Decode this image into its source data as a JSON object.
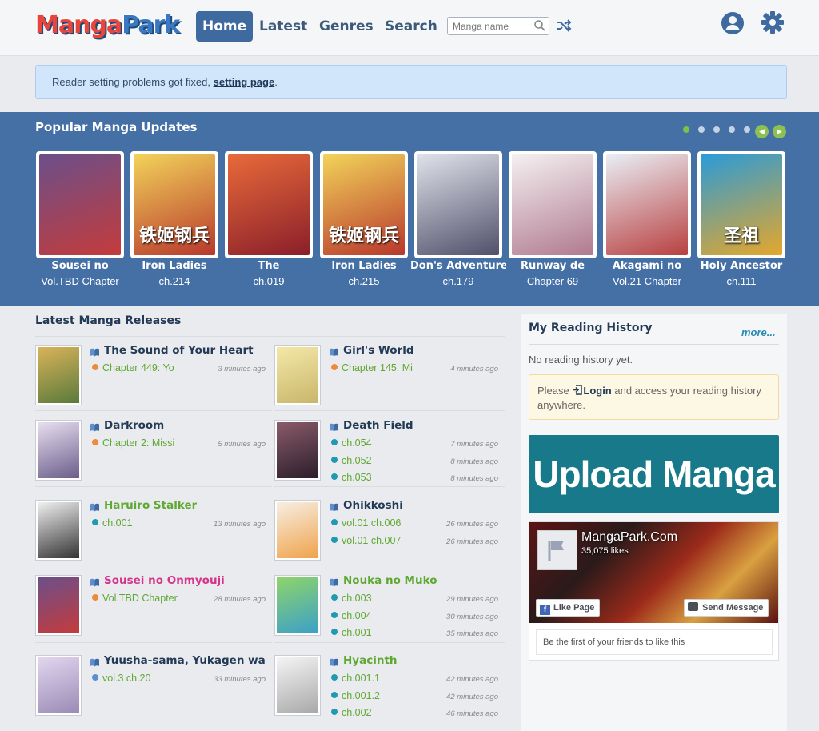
{
  "header": {
    "logo_a": "Manga",
    "logo_b": "Park",
    "nav": [
      "Home",
      "Latest",
      "Genres",
      "Search"
    ],
    "search_placeholder": "Manga name"
  },
  "notice": {
    "text": "Reader setting problems got fixed, ",
    "link": "setting page",
    "end": "."
  },
  "popular": {
    "title": "Popular Manga Updates",
    "items": [
      {
        "name": "Sousei no",
        "chapter": "Vol.TBD Chapter",
        "c1": "#6b4f8a",
        "c2": "#c43b3b"
      },
      {
        "name": "Iron Ladies",
        "chapter": "ch.214",
        "c1": "#f2d35a",
        "c2": "#b8382c",
        "mark": "铁姬钢兵"
      },
      {
        "name": "The",
        "chapter": "ch.019",
        "c1": "#e86a3a",
        "c2": "#8a1f2a"
      },
      {
        "name": "Iron Ladies",
        "chapter": "ch.215",
        "c1": "#f2d35a",
        "c2": "#b8382c",
        "mark": "铁姬钢兵"
      },
      {
        "name": "Don's Adventure",
        "chapter": "ch.179",
        "c1": "#dfe2ea",
        "c2": "#50506a"
      },
      {
        "name": "Runway de",
        "chapter": "Chapter 69",
        "c1": "#f4f0f2",
        "c2": "#b07a8e"
      },
      {
        "name": "Akagami no",
        "chapter": "Vol.21 Chapter",
        "c1": "#e9eef5",
        "c2": "#b84040"
      },
      {
        "name": "Holy Ancestor",
        "chapter": "ch.111",
        "c1": "#2a9bd8",
        "c2": "#e6a72a",
        "mark": "圣祖"
      }
    ]
  },
  "latest": {
    "title": "Latest Manga Releases",
    "left": [
      {
        "title": "The Sound of Your Heart",
        "color": "#233a56",
        "c1": "#d9b35a",
        "c2": "#5a7a3a",
        "chapters": [
          {
            "text": "Chapter 449: Yo",
            "time": "3 minutes ago",
            "bullet": "#ee8a3a",
            "color": "#5fa832"
          }
        ]
      },
      {
        "title": "Darkroom",
        "color": "#233a56",
        "c1": "#e7dff0",
        "c2": "#6b5d8a",
        "chapters": [
          {
            "text": "Chapter 2: Missi",
            "time": "5 minutes ago",
            "bullet": "#ee8a3a",
            "color": "#5fa832"
          }
        ]
      },
      {
        "title": "Haruiro Stalker",
        "color": "#5fa832",
        "c1": "#f0f0f0",
        "c2": "#333333",
        "chapters": [
          {
            "text": "ch.001",
            "time": "13 minutes ago",
            "bullet": "#1f9ab0",
            "color": "#5fa832"
          }
        ]
      },
      {
        "title": "Sousei no Onmyouji",
        "color": "#d6338a",
        "c1": "#6b4f8a",
        "c2": "#c43b3b",
        "chapters": [
          {
            "text": "Vol.TBD Chapter",
            "time": "28 minutes ago",
            "bullet": "#ee8a3a",
            "color": "#5fa832"
          }
        ]
      },
      {
        "title": "Yuusha-sama, Yukagen wa",
        "color": "#233a56",
        "c1": "#e2d6ef",
        "c2": "#9a8ab5",
        "chapters": [
          {
            "text": "vol.3 ch.20",
            "time": "33 minutes ago",
            "bullet": "#5b8fd0",
            "color": "#5fa832"
          }
        ]
      }
    ],
    "right": [
      {
        "title": "Girl's World",
        "color": "#233a56",
        "c1": "#f4e8a8",
        "c2": "#c8b66a",
        "chapters": [
          {
            "text": "Chapter 145: Mi",
            "time": "4 minutes ago",
            "bullet": "#ee8a3a",
            "color": "#5fa832"
          }
        ]
      },
      {
        "title": "Death Field",
        "color": "#233a56",
        "c1": "#8a5a6a",
        "c2": "#2a1e2a",
        "chapters": [
          {
            "text": "ch.054",
            "time": "7 minutes ago",
            "bullet": "#1f9ab0",
            "color": "#5fa832"
          },
          {
            "text": "ch.052",
            "time": "8 minutes ago",
            "bullet": "#1f9ab0",
            "color": "#5fa832"
          },
          {
            "text": "ch.053",
            "time": "8 minutes ago",
            "bullet": "#1f9ab0",
            "color": "#5fa832"
          }
        ]
      },
      {
        "title": "Ohikkoshi",
        "color": "#233a56",
        "c1": "#f6efe4",
        "c2": "#f0a24a",
        "chapters": [
          {
            "text": "vol.01 ch.006",
            "time": "26 minutes ago",
            "bullet": "#1f9ab0",
            "color": "#5fa832"
          },
          {
            "text": "vol.01 ch.007",
            "time": "26 minutes ago",
            "bullet": "#1f9ab0",
            "color": "#5fa832"
          }
        ]
      },
      {
        "title": "Nouka no Muko",
        "color": "#5fa832",
        "c1": "#8fd46a",
        "c2": "#3aa0c8",
        "chapters": [
          {
            "text": "ch.003",
            "time": "29 minutes ago",
            "bullet": "#1f9ab0",
            "color": "#5fa832"
          },
          {
            "text": "ch.004",
            "time": "30 minutes ago",
            "bullet": "#1f9ab0",
            "color": "#5fa832"
          },
          {
            "text": "ch.001",
            "time": "35 minutes ago",
            "bullet": "#1f9ab0",
            "color": "#5fa832"
          }
        ]
      },
      {
        "title": "Hyacinth",
        "color": "#5fa832",
        "c1": "#f4f4f4",
        "c2": "#a8a8a8",
        "chapters": [
          {
            "text": "ch.001.1",
            "time": "42 minutes ago",
            "bullet": "#1f9ab0",
            "color": "#5fa832"
          },
          {
            "text": "ch.001.2",
            "time": "42 minutes ago",
            "bullet": "#1f9ab0",
            "color": "#5fa832"
          },
          {
            "text": "ch.002",
            "time": "46 minutes ago",
            "bullet": "#1f9ab0",
            "color": "#5fa832"
          }
        ]
      }
    ]
  },
  "history": {
    "title": "My Reading History",
    "more": "more...",
    "empty": "No reading history yet.",
    "login_pre": "Please ",
    "login_link": "Login",
    "login_post": " and access your reading history anywhere."
  },
  "upload": {
    "label": "Upload Manga"
  },
  "facebook": {
    "name": "MangaPark.Com",
    "likes": "35,075 likes",
    "like_btn": "Like Page",
    "msg_btn": "Send Message",
    "footer": "Be the first of your friends to like this"
  }
}
